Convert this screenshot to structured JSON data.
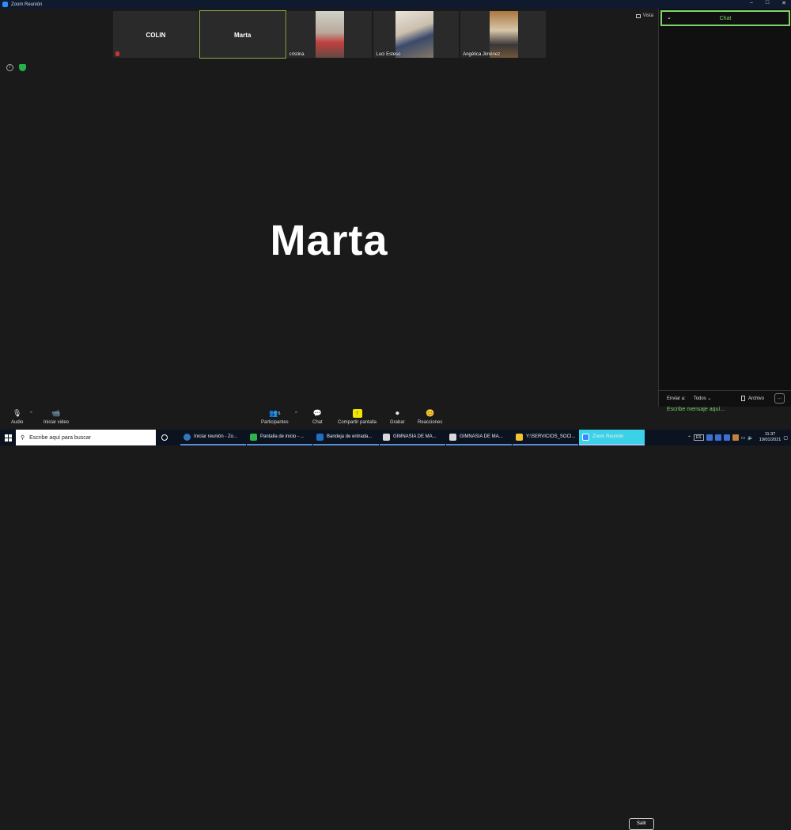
{
  "window": {
    "title": "Zoom Reunión",
    "controls": [
      "–",
      "□",
      "✕"
    ]
  },
  "gallery": [
    {
      "name": "COLIN",
      "muted": true,
      "has_video": false
    },
    {
      "name": "Marta",
      "active": true,
      "has_video": false
    },
    {
      "label": "cristina",
      "has_video": true
    },
    {
      "label": "Luci Esteso",
      "has_video": true
    },
    {
      "label": "Angélica Jiménez",
      "has_video": true
    }
  ],
  "view_button": "Vista",
  "speaker": {
    "name": "Marta"
  },
  "chat": {
    "title": "Chat",
    "send_to_label": "Enviar a:",
    "send_to_value": "Todos",
    "file_label": "Archivo",
    "more": "...",
    "input_placeholder": "Escribe mensaje aquí..."
  },
  "toolbar": {
    "audio": "Audio",
    "video": "Iniciar video",
    "participants": "Participantes",
    "participants_count": "5",
    "chat": "Chat",
    "share": "Compartir pantalla",
    "record": "Grabar",
    "reactions": "Reacciones",
    "leave": "Salir"
  },
  "taskbar": {
    "search_placeholder": "Escribe aquí para buscar",
    "items": [
      {
        "label": "Iniciar reunión - Zo...",
        "color": "#3277bc"
      },
      {
        "label": "Pantalla de inicio - ...",
        "color": "#2fb14c"
      },
      {
        "label": "Bandeja de entrada...",
        "color": "#1f6fc4"
      },
      {
        "label": "GIMNASIA DE MA...",
        "color": "#d9d9d9"
      },
      {
        "label": "GIMNASIA DE MA...",
        "color": "#d9d9d9"
      },
      {
        "label": "Y:\\SERVICIOS_SOCI...",
        "color": "#f4c430"
      },
      {
        "label": "Zoom Reunión",
        "color": "#2d8cff"
      }
    ],
    "lang": "ES",
    "time": "11:37",
    "date": "19/01/2021"
  },
  "colors": {
    "accent_green": "#7fd36a",
    "zoom_blue": "#2d8cff"
  }
}
